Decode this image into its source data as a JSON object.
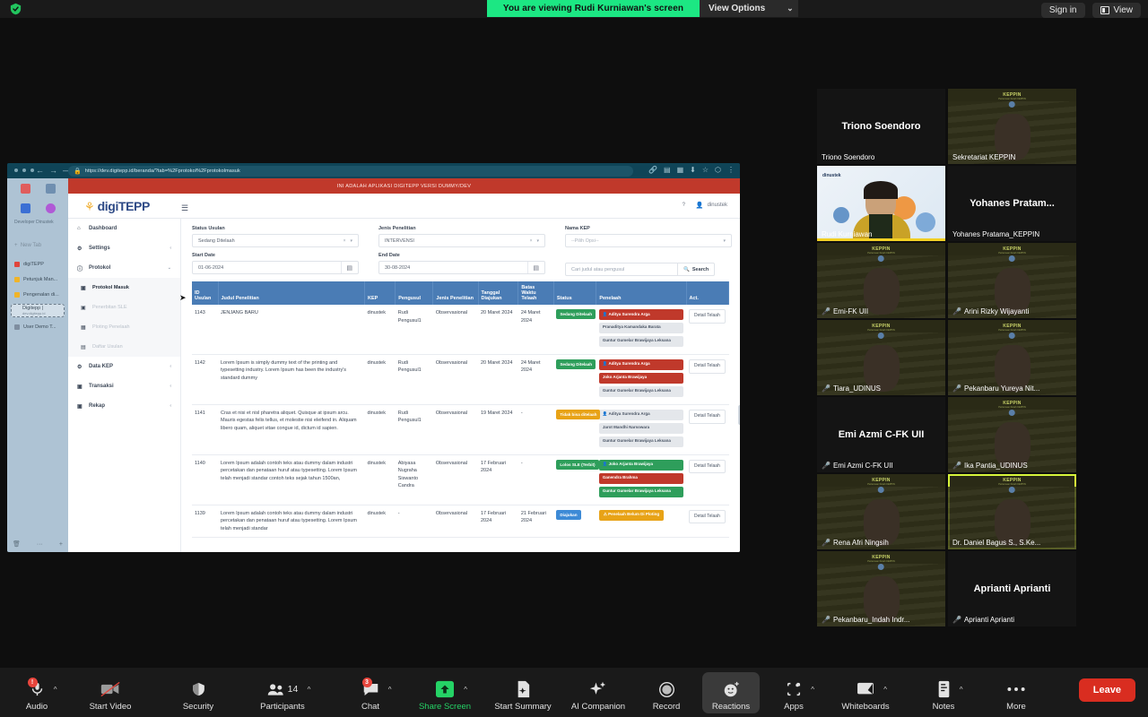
{
  "topbar": {
    "viewing_banner": "You are viewing Rudi Kurniawan's screen",
    "view_options": "View Options",
    "chevron": "⌄",
    "sign_in": "Sign in",
    "view": "View"
  },
  "browser": {
    "url": "https://dev.digitepp.id/beranda/?tab=%2Fprotokol%2Fprotokolmasuk",
    "lock": "🔒",
    "profile": "Developer Dinustek",
    "new_tab": "New Tab",
    "tabs": [
      {
        "label": "digiTEPP",
        "sub": ""
      },
      {
        "label": "Petunjuk Man...",
        "sub": ""
      },
      {
        "label": "Pengenalan di...",
        "sub": ""
      },
      {
        "label": "Digitepp |",
        "sub": "dev.digitepp.id"
      },
      {
        "label": "User Demo T...",
        "sub": ""
      }
    ]
  },
  "app": {
    "dummy_banner": "INI ADALAH APLIKASI DIGITEPP VERSI DUMMY/DEV",
    "logo_text": "digiTEPP",
    "user": "dinustek",
    "help": "?",
    "sidebar": [
      {
        "label": "Dashboard",
        "icon": "dashboard-icon",
        "caret": ""
      },
      {
        "label": "Settings",
        "icon": "gear-icon",
        "caret": "‹"
      },
      {
        "label": "Protokol",
        "icon": "info-icon",
        "caret": "⌄"
      }
    ],
    "sidebar_sub": [
      {
        "label": "Protokol Masuk",
        "state": "cur"
      },
      {
        "label": "Penerbitan SLE",
        "state": "dim"
      },
      {
        "label": "Ploting Penelaah",
        "state": "dim"
      },
      {
        "label": "Daftar Usulan",
        "state": "dim"
      }
    ],
    "sidebar_rest": [
      {
        "label": "Data KEP",
        "icon": "gear-icon",
        "caret": "‹"
      },
      {
        "label": "Transaksi",
        "icon": "doc-icon",
        "caret": "‹"
      },
      {
        "label": "Rekap",
        "icon": "doc-icon",
        "caret": "‹"
      }
    ]
  },
  "filters": {
    "status_label": "Status Usulan",
    "status_value": "Sedang Ditelaah",
    "jenis_label": "Jenis Penelitian",
    "jenis_value": "INTERVENSI",
    "kep_label": "Nama KEP",
    "kep_value": "--Pilih Opsi--",
    "start_label": "Start Date",
    "start_value": "01-06-2024",
    "end_label": "End Date",
    "end_value": "30-08-2024",
    "search_placeholder": "Cari judul atau pengusul",
    "search_button": "Search"
  },
  "table": {
    "headers": [
      "ID Usulan",
      "Judul Penelitian",
      "KEP",
      "Pengusul",
      "Jenis Penelitian",
      "Tanggal Diajukan",
      "Batas Waktu Telaah",
      "Status",
      "Penelaah",
      "Act."
    ],
    "rows": [
      {
        "id": "1143",
        "judul": "JENJANG BARU",
        "kep": "dinustek",
        "pengusul": "Rudi Pengusul1",
        "jenis": "Observasional",
        "tanggal": "20 Maret 2024",
        "batas": "24 Maret 2024",
        "status": {
          "text": "Sedang Ditelaah",
          "color": "b-green"
        },
        "penelaah": [
          {
            "text": "Aditya Surendra Arga",
            "color": "r-red",
            "icon": true
          },
          {
            "text": "Pranaditya Kamandaka Barata",
            "color": "r-gray",
            "icon": false
          },
          {
            "text": "Guntur Gumelar Brawijaya Leksana",
            "color": "r-gray",
            "icon": false
          }
        ],
        "act": "Detail Telaah"
      },
      {
        "id": "1142",
        "judul": "Lorem Ipsum is simply dummy text of the printing and typesetting industry. Lorem Ipsum has been the industry's standard dummy",
        "kep": "dinustek",
        "pengusul": "Rudi Pengusul1",
        "jenis": "Observasional",
        "tanggal": "20 Maret 2024",
        "batas": "24 Maret 2024",
        "status": {
          "text": "Sedang Ditelaah",
          "color": "b-green"
        },
        "penelaah": [
          {
            "text": "Aditya Surendra Arga",
            "color": "r-red",
            "icon": true
          },
          {
            "text": "Joko Arjanta Brawijaya",
            "color": "r-red",
            "icon": false
          },
          {
            "text": "Guntur Gumelar Brawijaya Leksana",
            "color": "r-gray",
            "icon": false
          }
        ],
        "act": "Detail Telaah"
      },
      {
        "id": "1141",
        "judul": "Cras et nisi et nisl pharetra aliquet. Quisque at ipsum arcu. Mauris egestas felis tellus, et molestie nisi eleifend in. Aliquam libero quam, aliquet vitae congue id, dictum id sapien.",
        "kep": "dinustek",
        "pengusul": "Rudi Pengusul1",
        "jenis": "Observasional",
        "tanggal": "19 Maret 2024",
        "batas": "-",
        "status": {
          "text": "Tidak bisa ditelaah",
          "color": "b-orange"
        },
        "penelaah": [
          {
            "text": "Aditya Surendra Arga",
            "color": "r-gray",
            "icon": true
          },
          {
            "text": "Jarot Mandhi Narsowara",
            "color": "r-gray",
            "icon": false
          },
          {
            "text": "Guntur Gumelar Brawijaya Leksana",
            "color": "r-gray",
            "icon": false
          }
        ],
        "act": "Detail Telaah"
      },
      {
        "id": "1140",
        "judul": "Lorem Ipsum adalah contoh teks atau dummy dalam industri percetakan dan penataan huruf atau typesetting. Lorem Ipsum telah menjadi standar contoh teks sejak tahun 1500an,",
        "kep": "dinustek",
        "pengusul": "Abiyasa Nugraha Siswanto Candra",
        "jenis": "Observasional",
        "tanggal": "17 Februari 2024",
        "batas": "-",
        "status": {
          "text": "Lolos SLE (Terbit)",
          "color": "b-green"
        },
        "penelaah": [
          {
            "text": "Joko Arjanta Brawijaya",
            "color": "r-green",
            "icon": true
          },
          {
            "text": "Ganendra Brahma",
            "color": "r-red",
            "icon": false
          },
          {
            "text": "Guntur Gumelar Brawijaya Leksana",
            "color": "r-green",
            "icon": false
          }
        ],
        "act": "Detail Telaah"
      },
      {
        "id": "1139",
        "judul": "Lorem Ipsum adalah contoh teks atau dummy dalam industri percetakan dan penataan huruf atau typesetting. Lorem Ipsum telah menjadi standar",
        "kep": "dinustek",
        "pengusul": "-",
        "jenis": "Observasional",
        "tanggal": "17 Februari 2024",
        "batas": "21 Februari 2024",
        "status": {
          "text": "Diajukan",
          "color": "b-blue"
        },
        "penelaah_warn": "Penelaah Belum Di Ploting",
        "act": "Detail Telaah"
      }
    ]
  },
  "gallery": [
    {
      "name": "Trionо Soendoro",
      "display": "Trionо Soendoro",
      "type": "name",
      "muted": false,
      "active": false
    },
    {
      "name": "Sekretariat KEPPIN",
      "type": "video",
      "muted": false,
      "active": false
    },
    {
      "name": "Rudi Kurniawan",
      "type": "banner",
      "muted": false,
      "active": false
    },
    {
      "name": "Yohanes Pratama_KEPPIN",
      "display": "Yohanes  Pratam...",
      "type": "name",
      "muted": false,
      "active": false
    },
    {
      "name": "Emi-FK UII",
      "type": "video",
      "muted": true,
      "active": false
    },
    {
      "name": "Arini Rizky Wijayanti",
      "type": "video",
      "muted": true,
      "active": false
    },
    {
      "name": "Tiara_UDINUS",
      "type": "video",
      "muted": true,
      "active": false
    },
    {
      "name": "Pekanbaru Yureya Nit...",
      "type": "video",
      "muted": true,
      "active": false
    },
    {
      "name": "Emi Azmi C-FK UII",
      "display": "Emi Azmi C-FK UII",
      "type": "name",
      "muted": true,
      "active": false
    },
    {
      "name": "Ika Pantia_UDINUS",
      "type": "video",
      "muted": true,
      "active": false
    },
    {
      "name": "Rena Afri Ningsih",
      "type": "video",
      "muted": true,
      "active": false
    },
    {
      "name": "Dr. Daniel Bagus S., S.Ke...",
      "type": "video",
      "muted": false,
      "active": true
    },
    {
      "name": "Pekanbaru_Indah Indr...",
      "type": "video",
      "muted": true,
      "active": false
    },
    {
      "name": "Aprianti Aprianti",
      "display": "Aprianti Aprianti",
      "type": "name",
      "muted": true,
      "active": false
    }
  ],
  "toolbar": {
    "items": [
      {
        "label": "Audio",
        "icon": "microphone-icon",
        "chevron": true,
        "badge": "!",
        "green": false
      },
      {
        "label": "Start Video",
        "icon": "camera-off-icon",
        "chevron": false,
        "badge": "",
        "green": false
      },
      {
        "label": "Security",
        "icon": "shield-icon",
        "chevron": false,
        "badge": "",
        "green": false
      },
      {
        "label": "Participants",
        "icon": "people-icon",
        "chevron": true,
        "badge": "",
        "count": "14",
        "green": false
      },
      {
        "label": "Chat",
        "icon": "chat-icon",
        "chevron": true,
        "badge": "3",
        "green": false
      },
      {
        "label": "Share Screen",
        "icon": "share-screen-icon",
        "chevron": true,
        "badge": "",
        "green": true
      },
      {
        "label": "Start Summary",
        "icon": "summary-icon",
        "chevron": false,
        "badge": "",
        "green": false
      },
      {
        "label": "AI Companion",
        "icon": "sparkle-icon",
        "chevron": false,
        "badge": "",
        "green": false
      },
      {
        "label": "Record",
        "icon": "record-icon",
        "chevron": false,
        "badge": "",
        "green": false
      },
      {
        "label": "Reactions",
        "icon": "reactions-icon",
        "chevron": false,
        "badge": "",
        "green": false
      },
      {
        "label": "Apps",
        "icon": "apps-icon",
        "chevron": true,
        "badge": "",
        "green": false
      },
      {
        "label": "Whiteboards",
        "icon": "whiteboard-icon",
        "chevron": true,
        "badge": "",
        "green": false
      },
      {
        "label": "Notes",
        "icon": "notes-icon",
        "chevron": true,
        "badge": "",
        "green": false
      },
      {
        "label": "More",
        "icon": "ellipsis-icon",
        "chevron": false,
        "badge": "",
        "green": false
      }
    ],
    "leave": "Leave"
  },
  "colors": {
    "share_banner": "#1ce783",
    "leave": "#d92d20",
    "table_header": "#4a7cb5",
    "dummy_banner": "#c0392b"
  }
}
